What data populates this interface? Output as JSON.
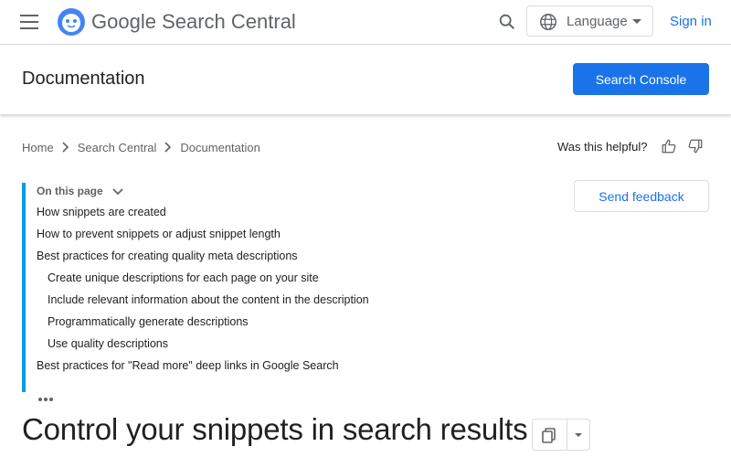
{
  "header": {
    "logo_google": "Google",
    "logo_product": "Search Central",
    "language_label": "Language",
    "signin_label": "Sign in"
  },
  "subheader": {
    "title": "Documentation",
    "console_button": "Search Console"
  },
  "breadcrumb": [
    "Home",
    "Search Central",
    "Documentation"
  ],
  "helpful": {
    "label": "Was this helpful?"
  },
  "feedback": {
    "label": "Send feedback"
  },
  "toc": {
    "heading": "On this page",
    "items": [
      {
        "label": "How snippets are created",
        "level": 1
      },
      {
        "label": "How to prevent snippets or adjust snippet length",
        "level": 1
      },
      {
        "label": "Best practices for creating quality meta descriptions",
        "level": 1
      },
      {
        "label": "Create unique descriptions for each page on your site",
        "level": 2
      },
      {
        "label": "Include relevant information about the content in the description",
        "level": 2
      },
      {
        "label": "Programmatically generate descriptions",
        "level": 2
      },
      {
        "label": "Use quality descriptions",
        "level": 2
      },
      {
        "label": "Best practices for \"Read more\" deep links in Google Search",
        "level": 1
      }
    ]
  },
  "page": {
    "title": "Control your snippets in search results"
  },
  "colors": {
    "accent": "#1a73e8",
    "toc_border": "#039be5",
    "divider": "#dadce0"
  }
}
